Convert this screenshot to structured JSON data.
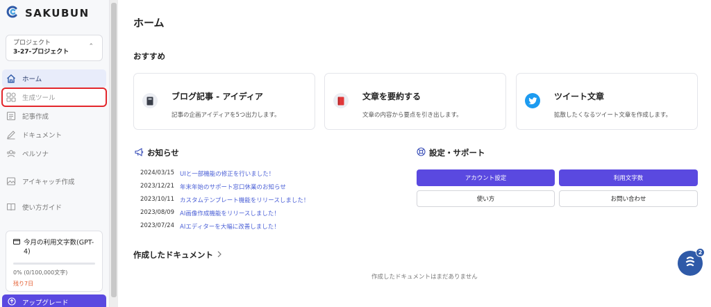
{
  "app": {
    "logo_text": "SAKUBUN"
  },
  "project": {
    "label": "プロジェクト",
    "name": "3-27-プロジェクト"
  },
  "sidebar": {
    "items": [
      {
        "label": "ホーム",
        "icon": "home-icon"
      },
      {
        "label": "生成ツール",
        "icon": "grid-icon"
      },
      {
        "label": "記事作成",
        "icon": "article-icon"
      },
      {
        "label": "ドキュメント",
        "icon": "pen-icon"
      },
      {
        "label": "ペルソナ",
        "icon": "users-icon"
      },
      {
        "label": "アイキャッチ作成",
        "icon": "image-icon"
      },
      {
        "label": "使い方ガイド",
        "icon": "book-icon"
      }
    ],
    "usage": {
      "title": "今月の利用文字数(GPT-4)",
      "count": "0% (0/100,000文字)",
      "remaining": "残り7日",
      "percent": 0
    },
    "upgrade_label": "アップグレード"
  },
  "main": {
    "title": "ホーム",
    "recommend_title": "おすすめ",
    "cards": [
      {
        "title": "ブログ記事 - アイディア",
        "desc": "記事の企画アイディアを5つ出力します。",
        "icon": "notebook-icon"
      },
      {
        "title": "文章を要約する",
        "desc": "文章の内容から要点を引き出します。",
        "icon": "red-book-icon"
      },
      {
        "title": "ツイート文章",
        "desc": "拡散したくなるツイート文章を作成します。",
        "icon": "twitter-icon"
      }
    ],
    "news_title": "お知らせ",
    "news": [
      {
        "date": "2024/03/15",
        "text": "UIと一部機能の修正を行いました！"
      },
      {
        "date": "2023/12/21",
        "text": "年末年始のサポート窓口休業のお知らせ"
      },
      {
        "date": "2023/10/11",
        "text": "カスタムテンプレート機能をリリースしました！"
      },
      {
        "date": "2023/08/09",
        "text": "AI画像作成機能をリリースしました！"
      },
      {
        "date": "2023/07/24",
        "text": "AIエディターを大幅に改善しました！"
      }
    ],
    "settings_title": "設定・サポート",
    "settings_buttons": {
      "account": "アカウント設定",
      "usage": "利用文字数",
      "howto": "使い方",
      "contact": "お問い合わせ"
    },
    "documents_title": "作成したドキュメント",
    "documents_empty": "作成したドキュメントはまだありません",
    "help_badge": "2",
    "colors": {
      "accent": "#5a49e0",
      "link": "#4a5fd6",
      "highlight": "#e3262b"
    }
  }
}
